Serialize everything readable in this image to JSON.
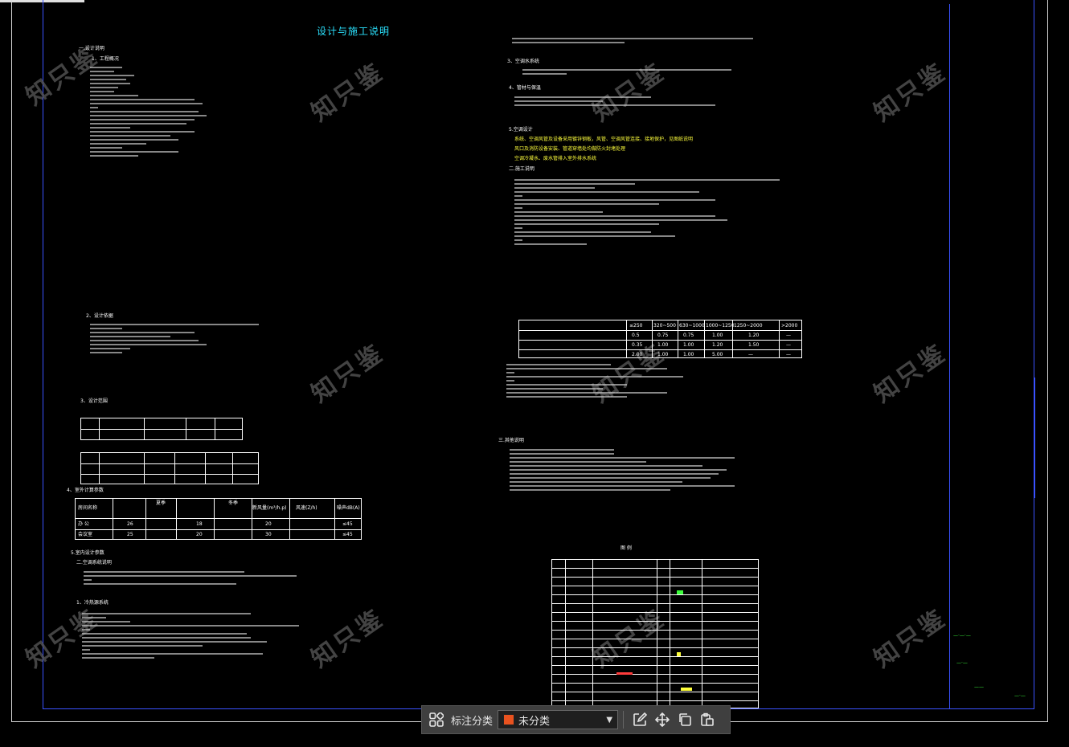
{
  "drawing": {
    "title": "设计与施工说明",
    "sections_left": [
      "一.设计说明",
      "1、工程概况",
      "2、设计依据",
      "3、设计范围",
      "4、室外计算参数",
      "5.室内设计参数",
      "二.空调系统说明",
      "1、冷热源系统",
      "2、空调风系统"
    ],
    "sections_right": [
      "3、空调水系统",
      "4、管材与保温",
      "5.空调设计",
      "二.施工说明",
      "三.其他说明",
      "图  例"
    ],
    "yellow_notes": [
      "系统、空调风管及设备采用镀锌钢板，风管、空调风管连接、接地保护，见图纸说明",
      "风口及消防设备安装、管道穿墙处均做防火封堵处理",
      "空调冷凝水、废水管排入室外排水系统"
    ],
    "indoor_table": {
      "headers": [
        "房间名称",
        "夏季",
        "冬季",
        "新风量(m³/h.p)",
        "风速(Z/h)",
        "噪声dB(A)"
      ],
      "rows": [
        [
          "办  公",
          "26",
          "",
          "18",
          "",
          "20",
          "",
          "≤45"
        ],
        [
          "会议室",
          "25",
          "",
          "20",
          "",
          "30",
          "",
          "≤45"
        ]
      ]
    },
    "duct_table": {
      "headers": [
        "≤250",
        "320~500",
        "630~1000",
        "1000~1250",
        "1250~2000",
        ">2000"
      ],
      "rows": [
        [
          "0.5",
          "0.75",
          "0.75",
          "1.00",
          "1.20",
          "—"
        ],
        [
          "0.35",
          "1.00",
          "1.00",
          "1.20",
          "1.50",
          "—"
        ],
        [
          "2.00",
          "1.00",
          "1.00",
          "5.00",
          "—",
          "—"
        ]
      ]
    },
    "watermark": "知只鉴"
  },
  "toolbar": {
    "label": "标注分类",
    "selected": "未分类",
    "swatch_color": "#e8521f",
    "icons": [
      "grid-icon",
      "edit-icon",
      "move-icon",
      "copy-icon",
      "paste-icon"
    ]
  }
}
